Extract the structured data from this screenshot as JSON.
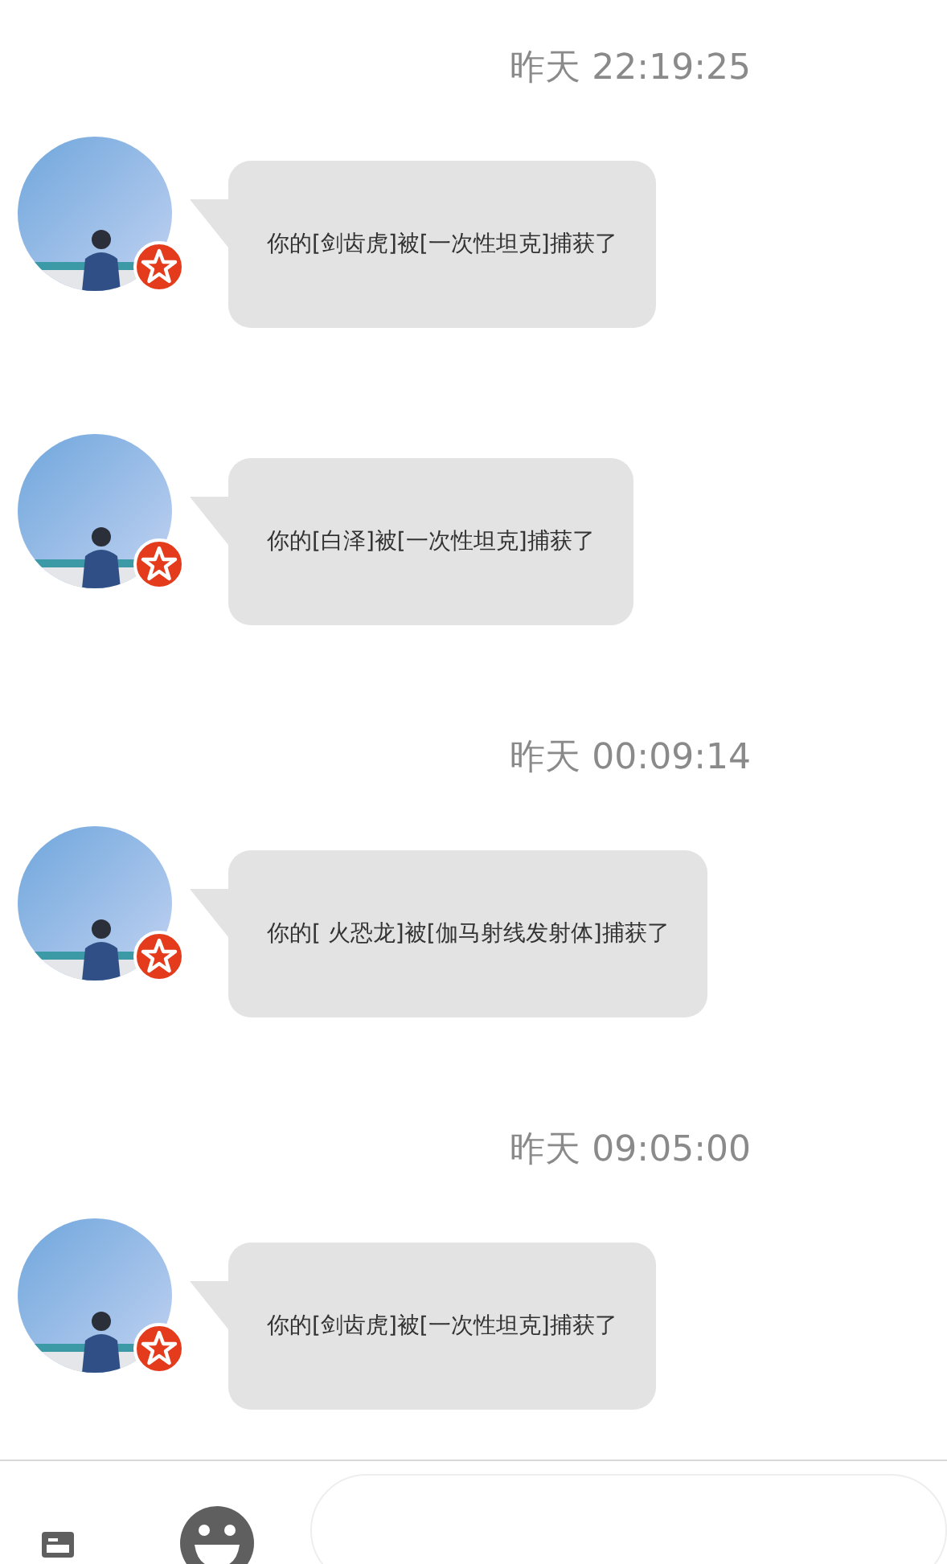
{
  "messages": [
    {
      "kind": "time",
      "text": "昨天 22:19:25"
    },
    {
      "kind": "message",
      "text": "你的[剑齿虎]被[一次性坦克]捕获了"
    },
    {
      "kind": "message",
      "text": "你的[白泽]被[一次性坦克]捕获了"
    },
    {
      "kind": "time",
      "text": "昨天 00:09:14"
    },
    {
      "kind": "message",
      "text": "你的[ 火恐龙]被[伽马射线发射体]捕获了"
    },
    {
      "kind": "time",
      "text": "昨天 09:05:00"
    },
    {
      "kind": "message",
      "text": "你的[剑齿虎]被[一次性坦克]捕获了"
    }
  ]
}
